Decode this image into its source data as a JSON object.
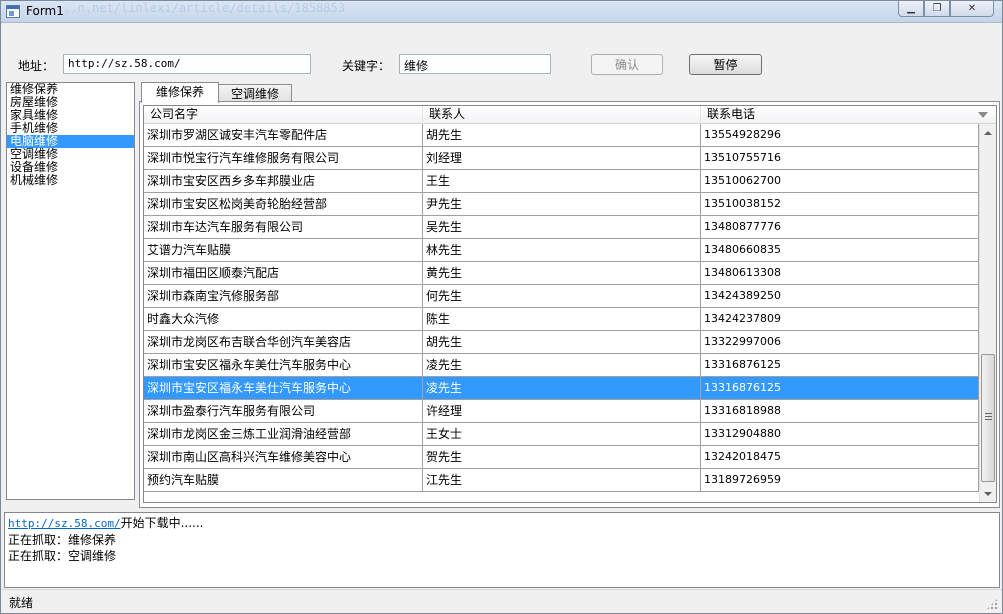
{
  "window": {
    "title": "Form1"
  },
  "ghost_text": "...n.net/linlexi/article/details/1858853",
  "toolbar": {
    "address_label": "地址：",
    "address_value": "http://sz.58.com/",
    "keyword_label": "关键字：",
    "keyword_value": "维修",
    "confirm_label": "确认",
    "pause_label": "暂停"
  },
  "categories": {
    "items": [
      "维修保养",
      "房屋维修",
      "家具维修",
      "手机维修",
      "电脑维修",
      "空调维修",
      "设备维修",
      "机械维修"
    ],
    "selected": "电脑维修"
  },
  "tabs": [
    {
      "label": "维修保养",
      "active": true
    },
    {
      "label": "空调维修",
      "active": false
    }
  ],
  "grid": {
    "columns": [
      "公司名字",
      "联系人",
      "联系电话"
    ],
    "rows": [
      [
        "深圳市罗湖区诚安丰汽车零配件店",
        "胡先生",
        "13554928296"
      ],
      [
        "深圳市悦宝行汽车维修服务有限公司",
        "刘经理",
        "13510755716"
      ],
      [
        "深圳市宝安区西乡多车邦膜业店",
        "王生",
        "13510062700"
      ],
      [
        "深圳市宝安区松岗美奇轮胎经营部",
        "尹先生",
        "13510038152"
      ],
      [
        "深圳市车达汽车服务有限公司",
        "吴先生",
        "13480877776"
      ],
      [
        "艾谱力汽车贴膜",
        "林先生",
        "13480660835"
      ],
      [
        "深圳市福田区顺泰汽配店",
        "黄先生",
        "13480613308"
      ],
      [
        "深圳市森南宝汽修服务部",
        "何先生",
        "13424389250"
      ],
      [
        "时鑫大众汽修",
        "陈生",
        "13424237809"
      ],
      [
        "深圳市龙岗区布吉联合华创汽车美容店",
        "胡先生",
        "13322997006"
      ],
      [
        "深圳市宝安区福永车美仕汽车服务中心",
        "凌先生",
        "13316876125"
      ],
      [
        "深圳市宝安区福永车美仕汽车服务中心",
        "凌先生",
        "13316876125"
      ],
      [
        "深圳市盈泰行汽车服务有限公司",
        "许经理",
        "13316818988"
      ],
      [
        "深圳市龙岗区金三炼工业润滑油经营部",
        "王女士",
        "13312904880"
      ],
      [
        "深圳市南山区高科兴汽车维修美容中心",
        "贺先生",
        "13242018475"
      ],
      [
        "预约汽车贴膜",
        "江先生",
        "13189726959"
      ]
    ],
    "selected_row": 11
  },
  "log": {
    "line1_link": "http://sz.58.com/",
    "line1_text": "开始下载中......",
    "line2": "正在抓取：维修保养",
    "line3": "正在抓取：空调维修"
  },
  "status": {
    "text": "就绪"
  },
  "colors": {
    "selection": "#3399ff",
    "link": "#0066cc"
  }
}
